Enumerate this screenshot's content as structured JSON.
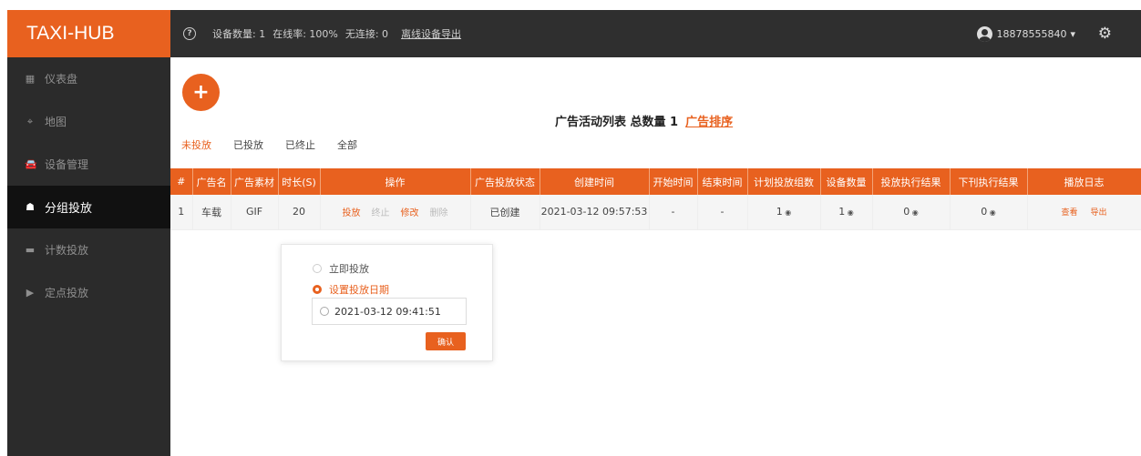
{
  "app": {
    "brand": "TAXI-HUB"
  },
  "topbar": {
    "help_icon": "question-circle-icon",
    "stat_devices": "设备数量: 1",
    "stat_online": "在线率: 100%",
    "stat_disconnected": "无连接: 0",
    "export_link": "离线设备导出",
    "user_phone": "18878555840",
    "user_caret": "▾",
    "settings_icon": "gear-icon"
  },
  "sidebar": {
    "items": [
      {
        "label": "仪表盘",
        "icon": "dashboard-icon",
        "glyph": "▦"
      },
      {
        "label": "地图",
        "icon": "map-icon",
        "glyph": "⌖"
      },
      {
        "label": "设备管理",
        "icon": "car-icon",
        "glyph": "🚘"
      },
      {
        "label": "分组投放",
        "icon": "group-icon",
        "glyph": "☗"
      },
      {
        "label": "计数投放",
        "icon": "count-icon",
        "glyph": "▬"
      },
      {
        "label": "定点投放",
        "icon": "play-icon",
        "glyph": "▶"
      }
    ]
  },
  "main": {
    "add_glyph": "+",
    "list_title": "广告活动列表 总数量 1",
    "sort_link": "广告排序",
    "tabs": [
      "未投放",
      "已投放",
      "已终止",
      "全部"
    ],
    "table": {
      "headers": [
        "#",
        "广告名",
        "广告素材",
        "时长(S)",
        "操作",
        "广告投放状态",
        "创建时间",
        "开始时间",
        "结束时间",
        "计划投放组数",
        "设备数量",
        "投放执行结果",
        "下刊执行结果",
        "播放日志"
      ],
      "row": {
        "index": "1",
        "name": "车载",
        "material": "GIF",
        "duration": "20",
        "op_play": "投放",
        "op_stop": "终止",
        "op_edit": "修改",
        "op_delete": "删除",
        "status": "已创建",
        "created": "2021-03-12 09:57:53",
        "start": "-",
        "end": "-",
        "planned_groups": "1",
        "device_count": "1",
        "play_result": "0",
        "offline_result": "0",
        "log_view": "查看",
        "log_export": "导出"
      }
    }
  },
  "popup": {
    "option_now": "立即投放",
    "option_date": "设置投放日期",
    "date_value": "2021-03-12 09:41:51",
    "confirm": "确认"
  },
  "colors": {
    "accent": "#e8611f",
    "topbar": "#2f2f2f",
    "sidebar": "#2b2b2b"
  }
}
